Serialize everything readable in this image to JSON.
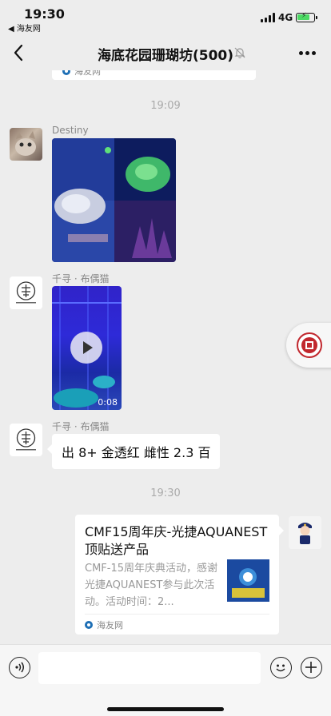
{
  "status_bar": {
    "time": "19:30",
    "back_app": "◀ 海友网",
    "network": "4G"
  },
  "nav": {
    "title": "海底花园珊瑚坊(500)"
  },
  "messages": {
    "partial_card_source": "海友网",
    "timestamp_1": "19:09",
    "destiny_name": "Destiny",
    "qianxun_name_1": "千寻 · 布偶猫",
    "video_duration": "0:08",
    "qianxun_name_2": "千寻 · 布偶猫",
    "text_msg": "出 8+ 金透红 雌性 2.3 百",
    "timestamp_2": "19:30"
  },
  "link_card": {
    "title": "CMF15周年庆-光捷AQUANEST顶贴送产品",
    "description": "CMF-15周年庆典活动，感谢光捷AQUANEST参与此次活动。活动时间：2...",
    "source": "海友网"
  },
  "icons": {
    "back": "chevron-left-icon",
    "mute": "bell-off-icon",
    "more": "more-dots-icon",
    "voice": "voice-icon",
    "emoji": "emoji-icon",
    "plus": "plus-icon",
    "play": "play-icon"
  },
  "colors": {
    "background": "#ededed",
    "bubble": "#ffffff",
    "battery": "#4cd964"
  }
}
